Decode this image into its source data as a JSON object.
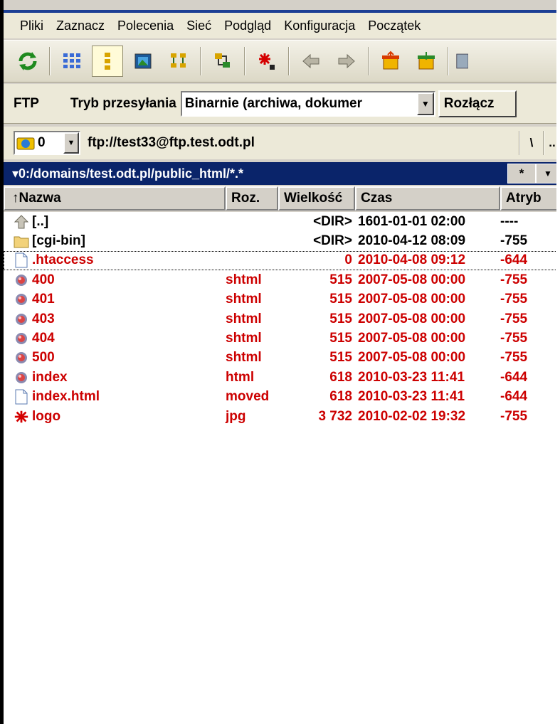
{
  "menu": {
    "items": [
      "Pliki",
      "Zaznacz",
      "Polecenia",
      "Sieć",
      "Podgląd",
      "Konfiguracja",
      "Początek"
    ]
  },
  "toolbar": {
    "buttons": [
      {
        "icon": "refresh-icon"
      },
      {
        "icon": "brief-view-icon"
      },
      {
        "icon": "full-view-icon",
        "pressed": true
      },
      {
        "icon": "thumbnail-view-icon"
      },
      {
        "icon": "tree-view-icon"
      },
      {
        "icon": "compare-dirs-icon"
      },
      {
        "icon": "select-group-icon"
      },
      {
        "icon": "back-arrow-icon"
      },
      {
        "icon": "forward-arrow-icon"
      },
      {
        "icon": "pack-archive-icon"
      },
      {
        "icon": "unpack-archive-icon"
      },
      {
        "icon": "ftp-connect-icon"
      }
    ]
  },
  "ftp": {
    "label": "FTP",
    "mode_label": "Tryb przesyłania",
    "mode_value": "Binarnie (archiwa, dokumer",
    "disconnect_label": "Rozłącz"
  },
  "path": {
    "drive_value": "0",
    "url": "ftp://test33@ftp.test.odt.pl",
    "root_button": "\\",
    "up_button": ".."
  },
  "dirbar": {
    "path": "▾0:/domains/test.odt.pl/public_html/*.*",
    "filter": "*"
  },
  "columns": {
    "name": "Nazwa",
    "ext": "Roz.",
    "size": "Wielkość",
    "time": "Czas",
    "attr": "Atryb"
  },
  "files": [
    {
      "name": "[..]",
      "ext": "",
      "size": "<DIR>",
      "time": "1601-01-01 02:00",
      "attr": "----",
      "icon": "up-dir-icon",
      "color": "black"
    },
    {
      "name": "[cgi-bin]",
      "ext": "",
      "size": "<DIR>",
      "time": "2010-04-12 08:09",
      "attr": "-755",
      "icon": "folder-icon",
      "color": "black"
    },
    {
      "name": ".htaccess",
      "ext": "",
      "size": "0",
      "time": "2010-04-08 09:12",
      "attr": "-644",
      "icon": "file-icon",
      "color": "red"
    },
    {
      "name": "400",
      "ext": "shtml",
      "size": "515",
      "time": "2007-05-08 00:00",
      "attr": "-755",
      "icon": "html-file-icon",
      "color": "red"
    },
    {
      "name": "401",
      "ext": "shtml",
      "size": "515",
      "time": "2007-05-08 00:00",
      "attr": "-755",
      "icon": "html-file-icon",
      "color": "red"
    },
    {
      "name": "403",
      "ext": "shtml",
      "size": "515",
      "time": "2007-05-08 00:00",
      "attr": "-755",
      "icon": "html-file-icon",
      "color": "red"
    },
    {
      "name": "404",
      "ext": "shtml",
      "size": "515",
      "time": "2007-05-08 00:00",
      "attr": "-755",
      "icon": "html-file-icon",
      "color": "red"
    },
    {
      "name": "500",
      "ext": "shtml",
      "size": "515",
      "time": "2007-05-08 00:00",
      "attr": "-755",
      "icon": "html-file-icon",
      "color": "red"
    },
    {
      "name": "index",
      "ext": "html",
      "size": "618",
      "time": "2010-03-23 11:41",
      "attr": "-644",
      "icon": "html-file-icon",
      "color": "red"
    },
    {
      "name": "index.html",
      "ext": "moved",
      "size": "618",
      "time": "2010-03-23 11:41",
      "attr": "-644",
      "icon": "file-icon",
      "color": "red"
    },
    {
      "name": "logo",
      "ext": "jpg",
      "size": "3 732",
      "time": "2010-02-02 19:32",
      "attr": "-755",
      "icon": "image-file-icon",
      "color": "red"
    }
  ],
  "colors": {
    "dirbar_bg": "#0a246a",
    "file_red": "#cc0000",
    "panel_bg": "#d4d0c8"
  }
}
